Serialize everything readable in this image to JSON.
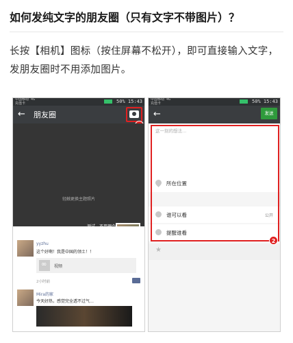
{
  "article": {
    "title": "如何发纯文字的朋友圈（只有文字不带图片）？",
    "body": "长按【相机】图标（按住屏幕不松开），即可直接输入文字，发朋友圈时不用添加图片。"
  },
  "left_phone": {
    "status": {
      "carrier": "中国移动 4G\n充值卡",
      "battery": "50%",
      "time": "15:43"
    },
    "nav": {
      "back": "←",
      "title": "朋友圈",
      "camera_icon": "camera-icon",
      "step": "1"
    },
    "cover": {
      "hint": "轻触更换主题照片",
      "name": "测试，不用理会"
    },
    "posts": [
      {
        "name": "yyzhu",
        "text": "这个好啊！我是中国的领土！！",
        "link": "视频",
        "time": "2小时前"
      },
      {
        "name": "Mira的家",
        "text": "今天好热，感觉完全透不过气…"
      }
    ]
  },
  "right_phone": {
    "status": {
      "carrier": "中国移动 4G\n充值卡",
      "battery": "50%",
      "time": "15:43"
    },
    "nav": {
      "back": "←",
      "send": "发送",
      "step": "2"
    },
    "compose": {
      "placeholder": "这一刻的想法..."
    },
    "location": "所在位置",
    "visibility": {
      "label": "谁可以看",
      "value": "公开"
    },
    "remind": "提醒谁看"
  },
  "colors": {
    "accent_red": "#e02020",
    "nav_dark": "#3a3d40",
    "send_green": "#2f9b3c",
    "name_blue": "#5a6c96"
  }
}
